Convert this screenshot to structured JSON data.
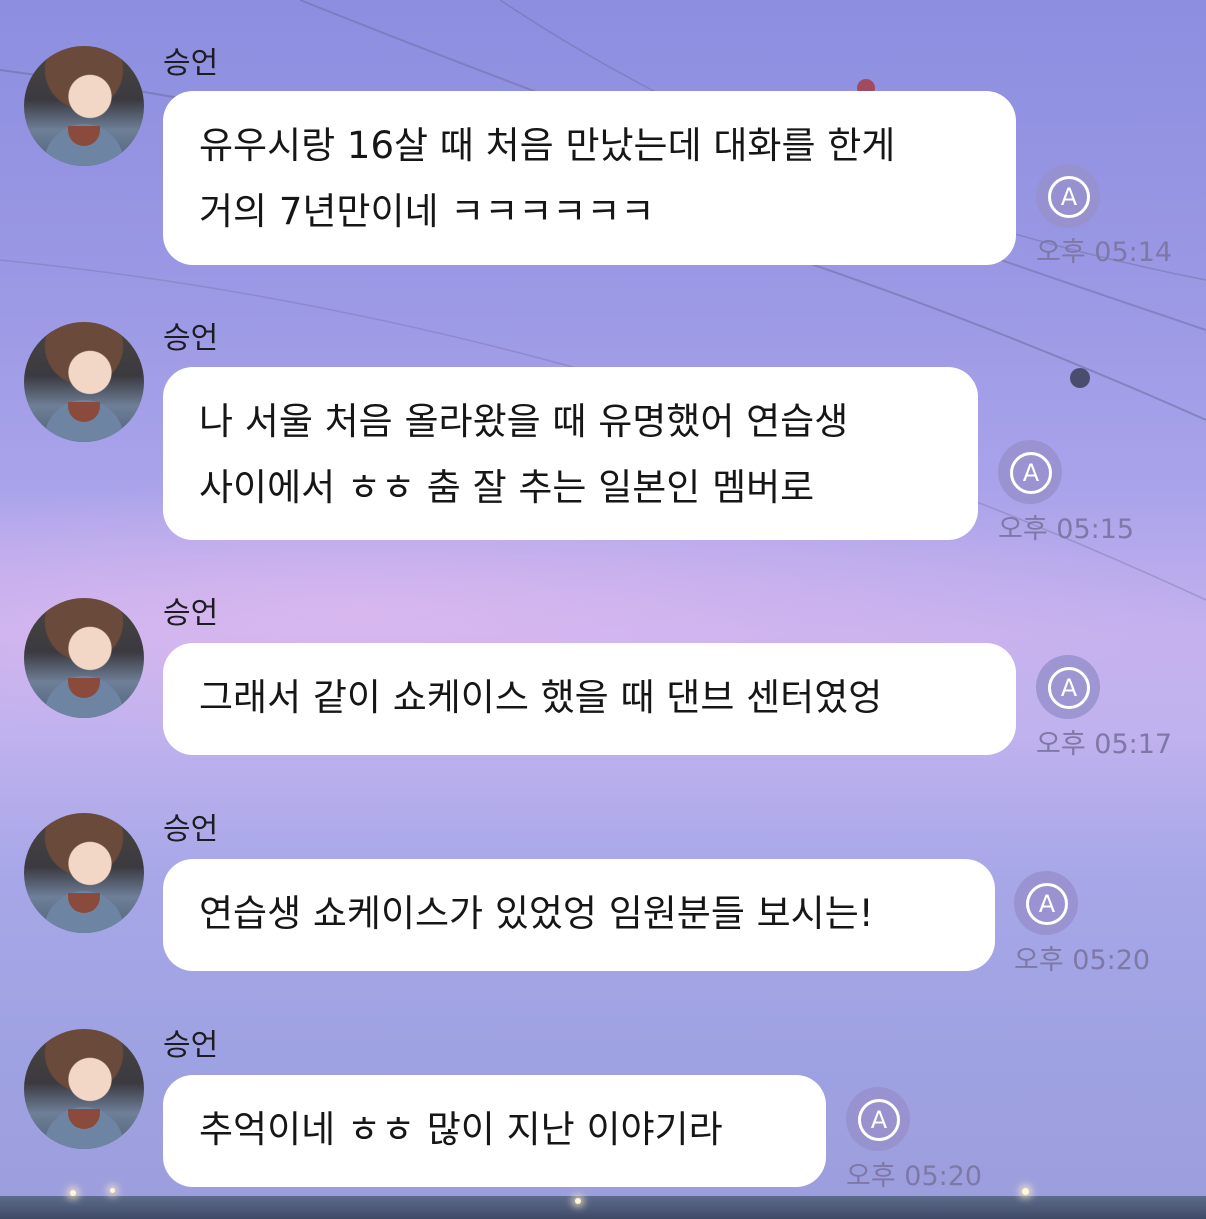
{
  "messages": [
    {
      "sender": "승언",
      "lines": [
        "유우시랑 16살 때 처음 만났는데 대화를 한게",
        "거의 7년만이네 ㅋㅋㅋㅋㅋㅋ"
      ],
      "time": "오후 05:14",
      "translate_icon": "A"
    },
    {
      "sender": "승언",
      "lines": [
        "나 서울 처음 올라왔을 때 유명했어 연습생",
        "사이에서 ㅎㅎ 춤 잘 추는 일본인 멤버로"
      ],
      "time": "오후 05:15",
      "translate_icon": "A"
    },
    {
      "sender": "승언",
      "lines": [
        "그래서 같이 쇼케이스 했을 때 댄브 센터였엉"
      ],
      "time": "오후 05:17",
      "translate_icon": "A"
    },
    {
      "sender": "승언",
      "lines": [
        "연습생 쇼케이스가 있었엉 임원분들 보시는!"
      ],
      "time": "오후 05:20",
      "translate_icon": "A"
    },
    {
      "sender": "승언",
      "lines": [
        "추억이네 ㅎㅎ 많이 지난 이야기라"
      ],
      "time": "오후 05:20",
      "translate_icon": "A"
    }
  ]
}
